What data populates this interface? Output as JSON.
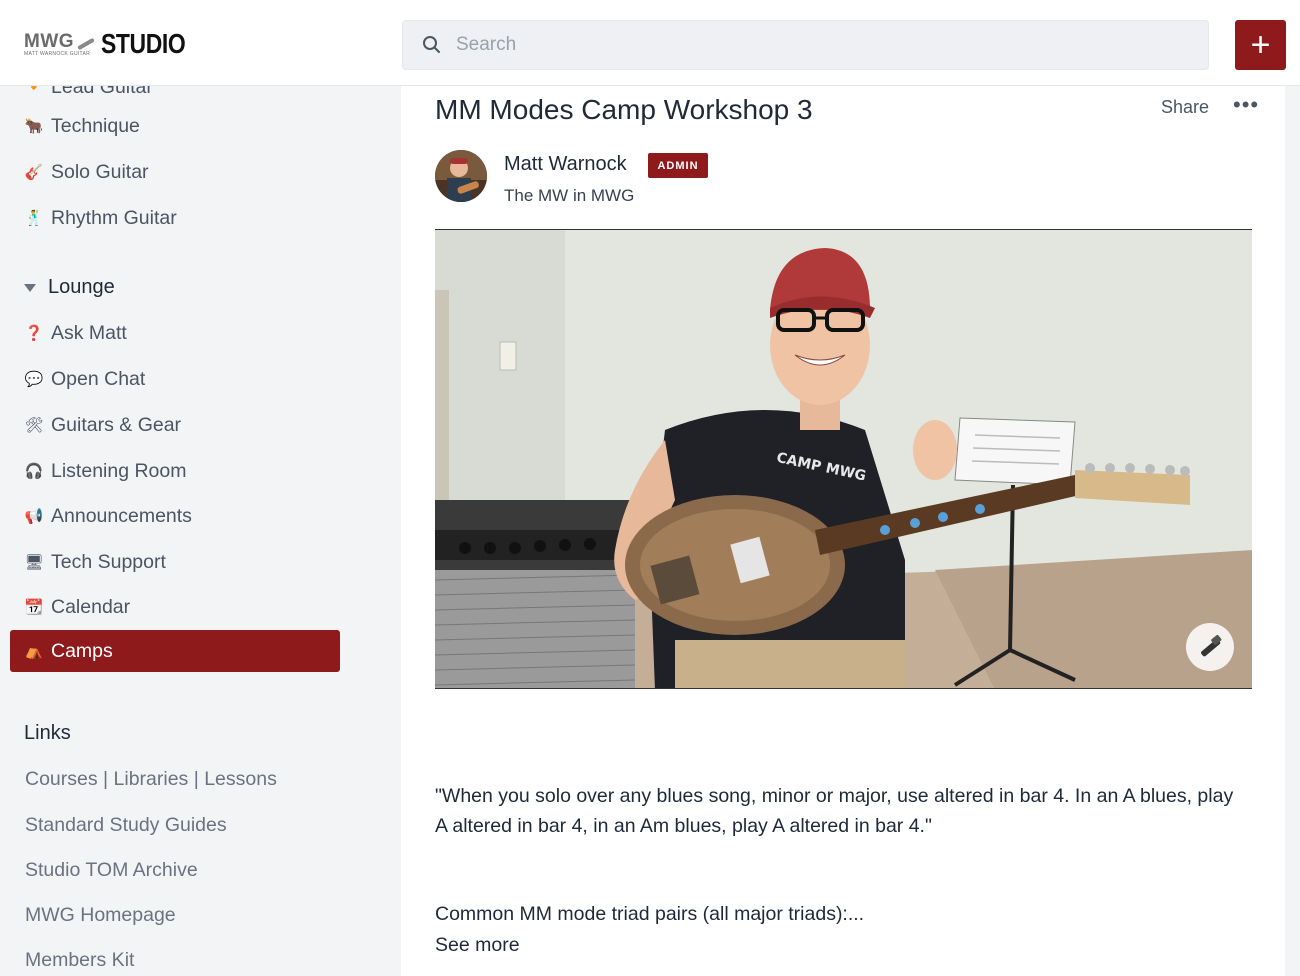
{
  "header": {
    "logo_mwg": "MWG",
    "logo_subtitle": "MATT WARNOCK GUITAR",
    "logo_studio": "STUDIO",
    "search_placeholder": "Search",
    "add_label": "+"
  },
  "sidebar": {
    "cut_item": {
      "emoji": "🔸",
      "label": "Lead Guitar"
    },
    "items": [
      {
        "emoji": "🐂",
        "label": "Technique"
      },
      {
        "emoji": "🎸",
        "label": "Solo Guitar"
      },
      {
        "emoji": "🕺",
        "label": "Rhythm Guitar"
      }
    ],
    "lounge_title": "Lounge",
    "lounge_items": [
      {
        "emoji": "❓",
        "label": "Ask Matt"
      },
      {
        "emoji": "💬",
        "label": "Open Chat"
      },
      {
        "emoji": "🛠",
        "label": "Guitars & Gear"
      },
      {
        "emoji": "🎧",
        "label": "Listening Room"
      },
      {
        "emoji": "📢",
        "label": "Announcements"
      },
      {
        "emoji": "🖥",
        "label": "Tech Support"
      },
      {
        "emoji": "📆",
        "label": "Calendar"
      },
      {
        "emoji": "⛺",
        "label": "Camps"
      }
    ],
    "active_item": "Camps",
    "links_title": "Links",
    "links": [
      "Courses | Libraries | Lessons",
      "Standard Study Guides",
      "Studio TOM Archive",
      "MWG Homepage",
      "Members Kit"
    ]
  },
  "post": {
    "title": "MM Modes Camp Workshop 3",
    "share_label": "Share",
    "more_label": "•••",
    "author": {
      "name": "Matt Warnock",
      "badge": "ADMIN",
      "tagline": "The MW in MWG"
    },
    "video_shirt_text": "CAMP MWG",
    "quote": "\"When you solo over any blues song, minor or major, use altered in bar 4. In an A blues, play A altered in bar 4, in an Am blues, play A altered in bar 4.\"",
    "excerpt": "Common MM mode triad pairs (all major triads):...",
    "see_more": "See more"
  },
  "colors": {
    "accent": "#8f1a1c",
    "sidebar_bg": "#f3f4f6",
    "card_bg": "#ffffff"
  }
}
